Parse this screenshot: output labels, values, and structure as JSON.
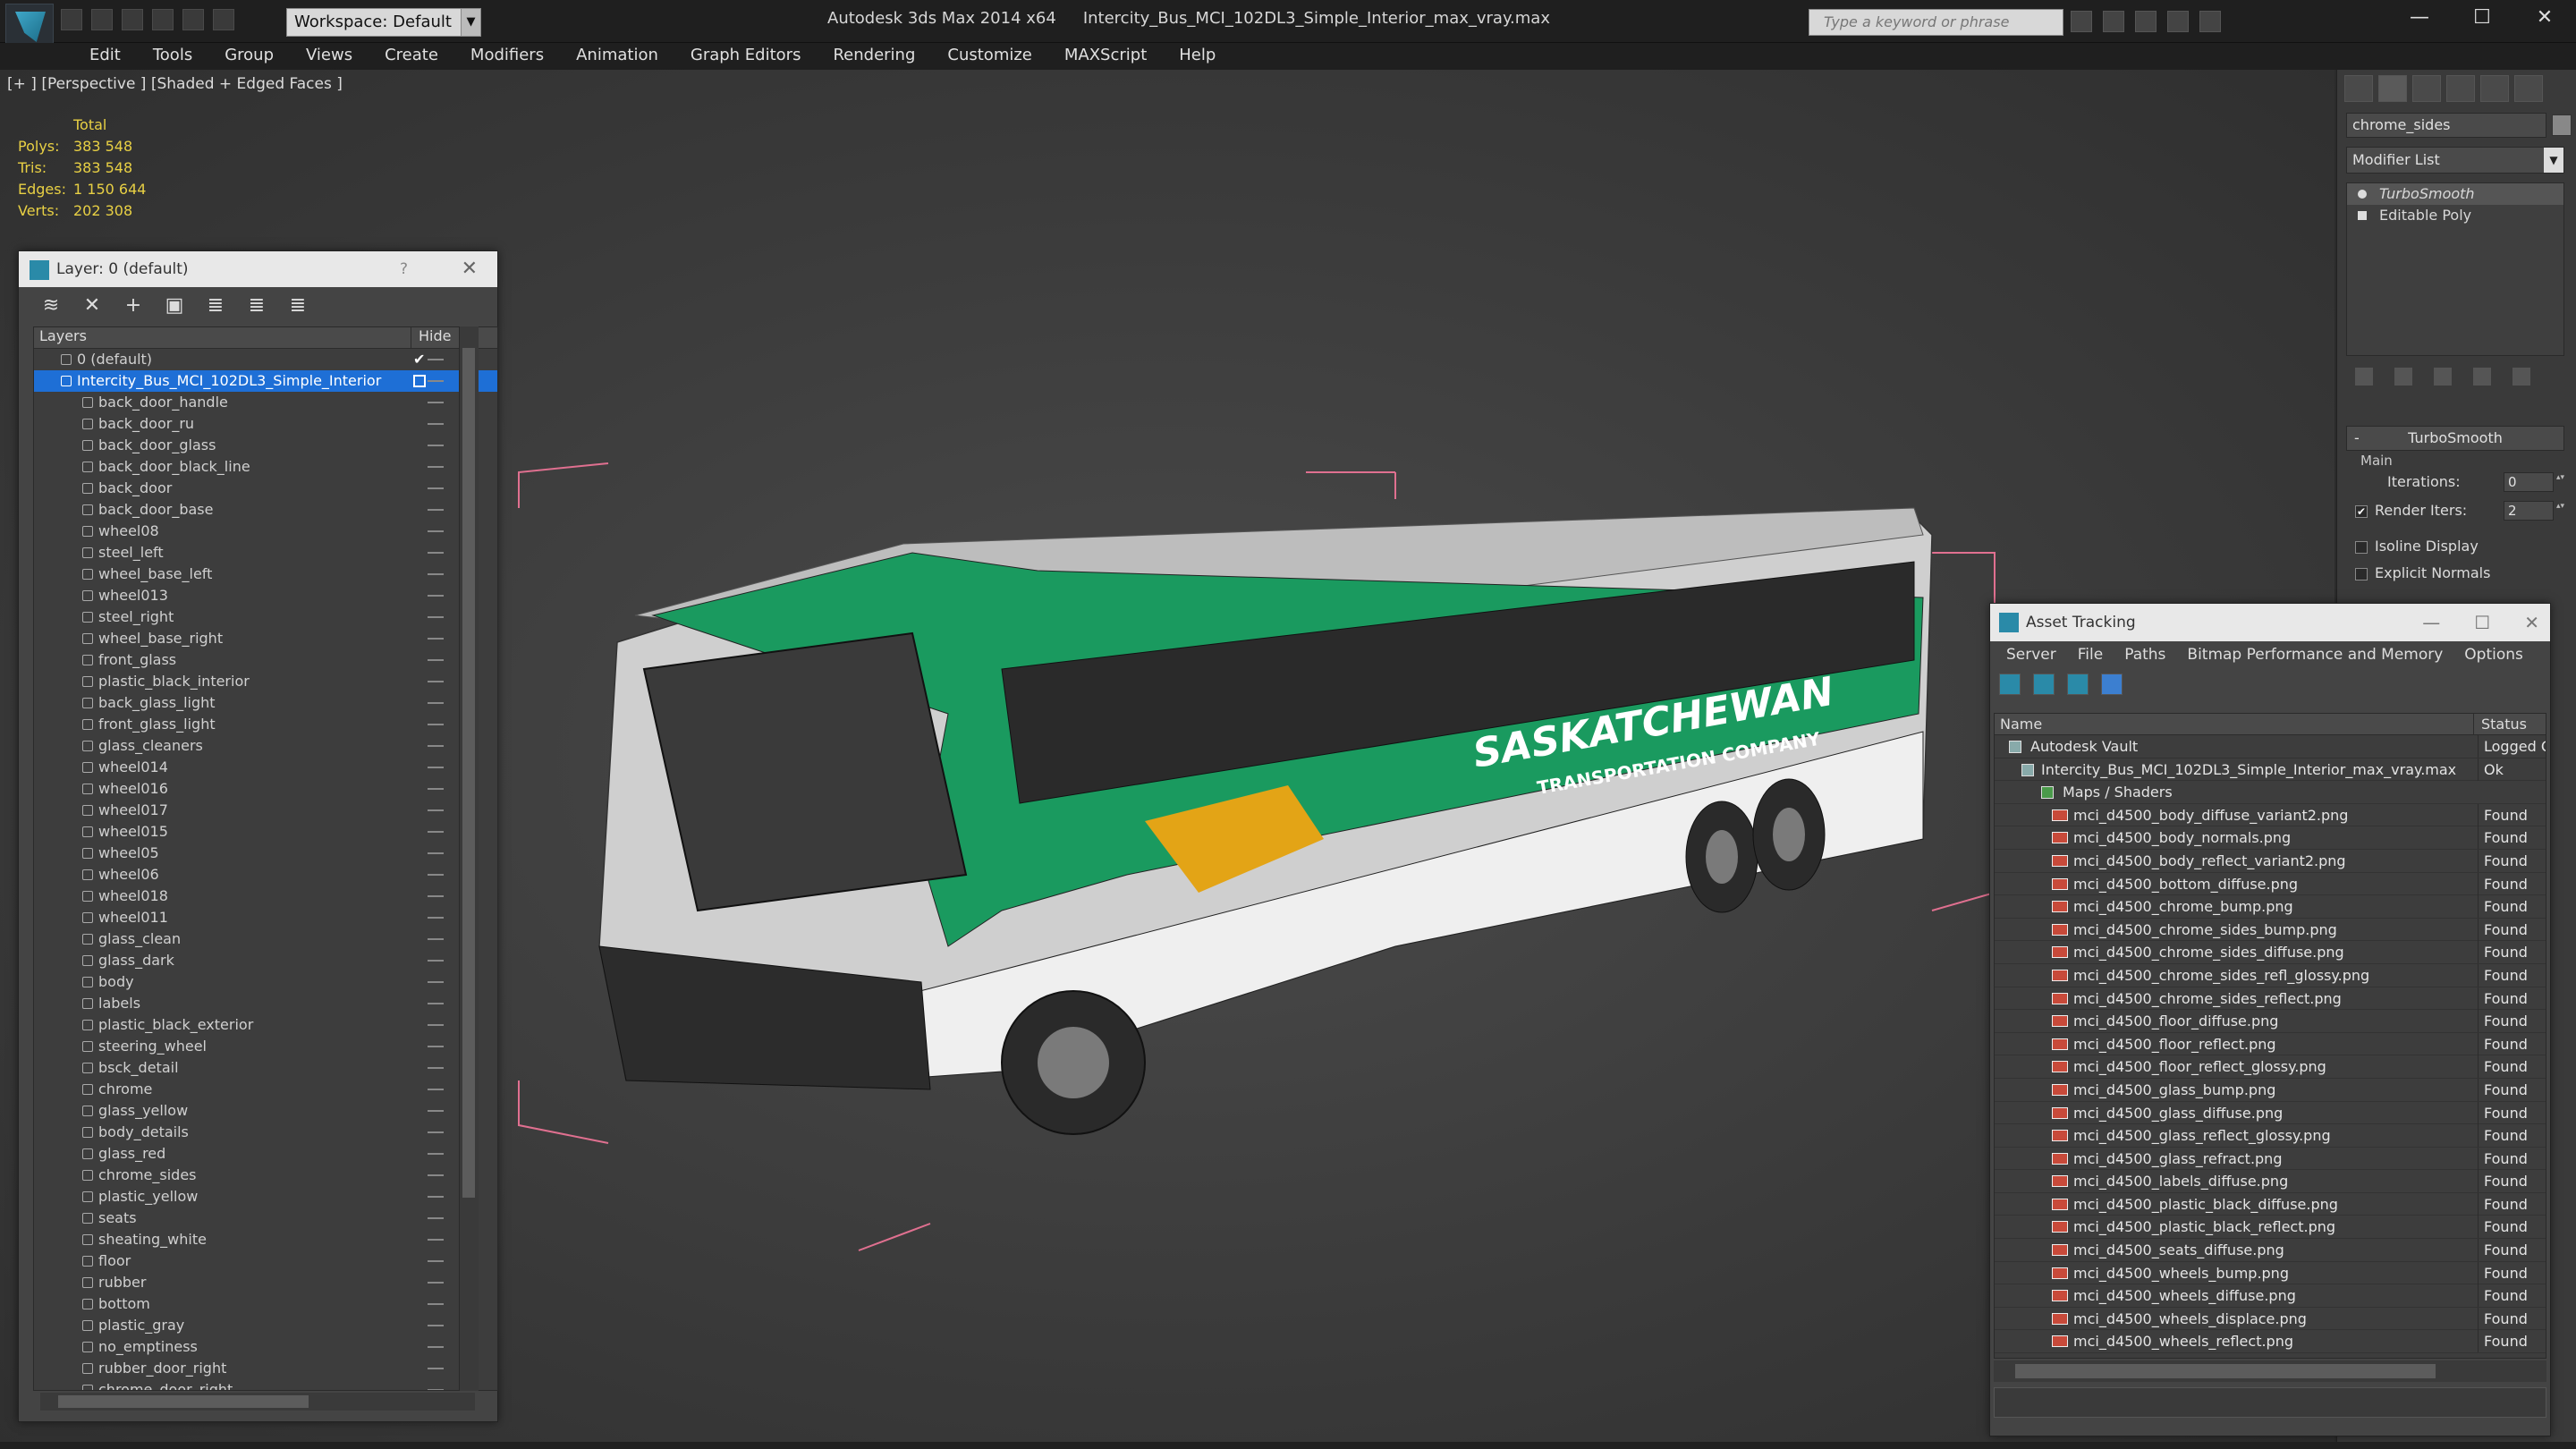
{
  "titlebar": {
    "workspace": "Workspace: Default",
    "app": "Autodesk 3ds Max  2014 x64",
    "file": "Intercity_Bus_MCI_102DL3_Simple_Interior_max_vray.max",
    "search_placeholder": "Type a keyword or phrase",
    "minimize": "—",
    "maximize": "☐",
    "close": "✕"
  },
  "menu": [
    "Edit",
    "Tools",
    "Group",
    "Views",
    "Create",
    "Modifiers",
    "Animation",
    "Graph Editors",
    "Rendering",
    "Customize",
    "MAXScript",
    "Help"
  ],
  "viewport": {
    "label": "[+ ] [Perspective ] [Shaded + Edged Faces ]",
    "stats": {
      "header": "Total",
      "polys_label": "Polys:",
      "polys": "383 548",
      "tris_label": "Tris:",
      "tris": "383 548",
      "edges_label": "Edges:",
      "edges": "1 150 644",
      "verts_label": "Verts:",
      "verts": "202 308"
    },
    "bus_text_1": "SASKATCHEWAN",
    "bus_text_2": "TRANSPORTATION COMPANY"
  },
  "layer_panel": {
    "title": "Layer: 0 (default)",
    "help": "?",
    "close": "✕",
    "col_layers": "Layers",
    "col_hide": "Hide",
    "default_layer": "0 (default)",
    "selected_layer": "Intercity_Bus_MCI_102DL3_Simple_Interior",
    "objects": [
      "back_door_handle",
      "back_door_ru",
      "back_door_glass",
      "back_door_black_line",
      "back_door",
      "back_door_base",
      "wheel08",
      "steel_left",
      "wheel_base_left",
      "wheel013",
      "steel_right",
      "wheel_base_right",
      "front_glass",
      "plastic_black_interior",
      "back_glass_light",
      "front_glass_light",
      "glass_cleaners",
      "wheel014",
      "wheel016",
      "wheel017",
      "wheel015",
      "wheel05",
      "wheel06",
      "wheel018",
      "wheel011",
      "glass_clean",
      "glass_dark",
      "body",
      "labels",
      "plastic_black_exterior",
      "steering_wheel",
      "bsck_detail",
      "chrome",
      "glass_yellow",
      "body_details",
      "glass_red",
      "chrome_sides",
      "plastic_yellow",
      "seats",
      "sheating_white",
      "floor",
      "rubber",
      "bottom",
      "plastic_gray",
      "no_emptiness",
      "rubber_door_right",
      "chrome_door_right"
    ]
  },
  "command_panel": {
    "object_name": "chrome_sides",
    "modifier_list": "Modifier List",
    "stack": [
      "TurboSmooth",
      "Editable Poly"
    ],
    "rollout": "TurboSmooth",
    "group": "Main",
    "iterations_label": "Iterations:",
    "iterations": "0",
    "render_iters_label": "Render Iters:",
    "render_iters": "2",
    "isoline": "Isoline Display",
    "explicit_normals": "Explicit Normals"
  },
  "asset_tracking": {
    "title": "Asset Tracking",
    "menu": [
      "Server",
      "File",
      "Paths",
      "Bitmap Performance and Memory",
      "Options"
    ],
    "col_name": "Name",
    "col_status": "Status",
    "vault": "Autodesk Vault",
    "vault_status": "Logged Out",
    "file": "Intercity_Bus_MCI_102DL3_Simple_Interior_max_vray.max",
    "file_status": "Ok",
    "maps": "Maps / Shaders",
    "found": "Found",
    "files": [
      "mci_d4500_body_diffuse_variant2.png",
      "mci_d4500_body_normals.png",
      "mci_d4500_body_reflect_variant2.png",
      "mci_d4500_bottom_diffuse.png",
      "mci_d4500_chrome_bump.png",
      "mci_d4500_chrome_sides_bump.png",
      "mci_d4500_chrome_sides_diffuse.png",
      "mci_d4500_chrome_sides_refl_glossy.png",
      "mci_d4500_chrome_sides_reflect.png",
      "mci_d4500_floor_diffuse.png",
      "mci_d4500_floor_reflect.png",
      "mci_d4500_floor_reflect_glossy.png",
      "mci_d4500_glass_bump.png",
      "mci_d4500_glass_diffuse.png",
      "mci_d4500_glass_reflect_glossy.png",
      "mci_d4500_glass_refract.png",
      "mci_d4500_labels_diffuse.png",
      "mci_d4500_plastic_black_diffuse.png",
      "mci_d4500_plastic_black_reflect.png",
      "mci_d4500_seats_diffuse.png",
      "mci_d4500_wheels_bump.png",
      "mci_d4500_wheels_diffuse.png",
      "mci_d4500_wheels_displace.png",
      "mci_d4500_wheels_reflect.png"
    ]
  }
}
